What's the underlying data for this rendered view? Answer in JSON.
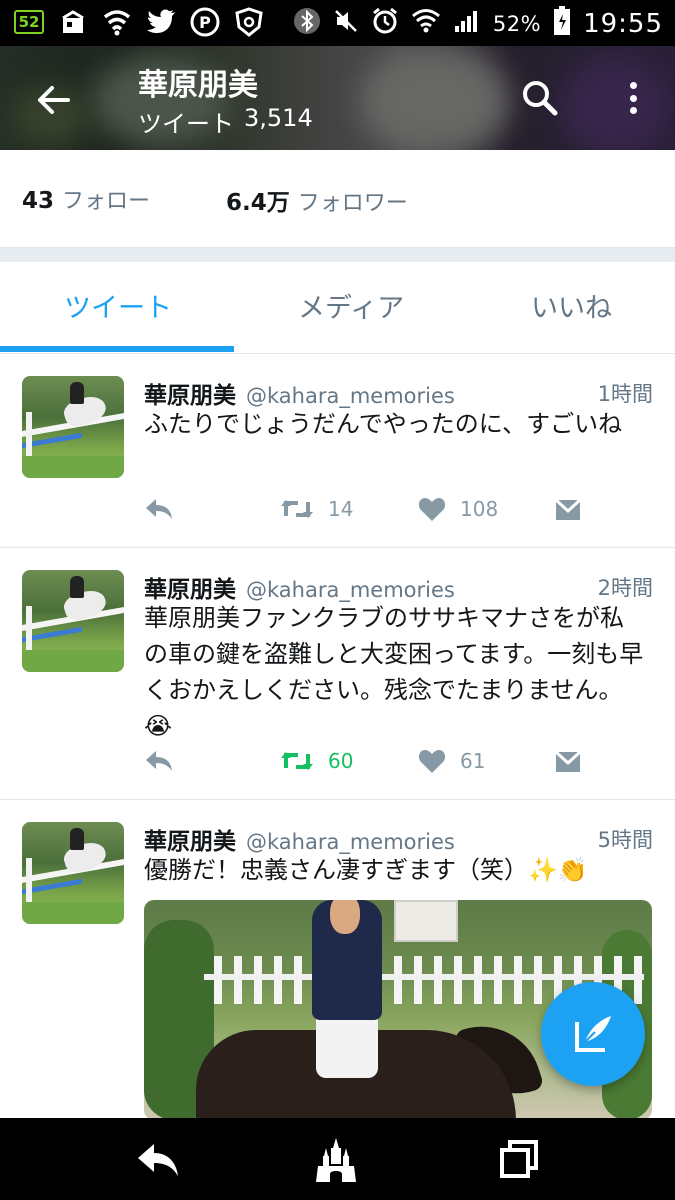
{
  "status_bar": {
    "notification_badge": "52",
    "battery_percent": "52%",
    "time": "19:55"
  },
  "header": {
    "name": "華原朋美",
    "tweets_label": "ツイート",
    "tweets_count": "3,514"
  },
  "stats": {
    "following_count": "43",
    "following_label": "フォロー",
    "followers_count": "6.4万",
    "followers_label": "フォロワー"
  },
  "tabs": [
    {
      "label": "ツイート",
      "active": true
    },
    {
      "label": "メディア",
      "active": false
    },
    {
      "label": "いいね",
      "active": false
    }
  ],
  "tweets": [
    {
      "name": "華原朋美",
      "handle": "@kahara_memories",
      "time": "1時間",
      "text": "ふたりでじょうだんでやったのに、すごいね",
      "retweets": "14",
      "likes": "108",
      "retweeted": false
    },
    {
      "name": "華原朋美",
      "handle": "@kahara_memories",
      "time": "2時間",
      "text": "華原朋美ファンクラブのササキマナさをが私の車の鍵を盗難しと大変困ってます。一刻も早くおかえしください。残念でたまりません。😭",
      "retweets": "60",
      "likes": "61",
      "retweeted": true
    },
    {
      "name": "華原朋美",
      "handle": "@kahara_memories",
      "time": "5時間",
      "text": "優勝だ！忠義さん凄すぎます（笑）✨👏",
      "has_media": true
    }
  ],
  "colors": {
    "accent": "#1da1f2",
    "retweet_active": "#17bf63",
    "secondary_text": "#657786",
    "action_icon": "#8899a6"
  }
}
